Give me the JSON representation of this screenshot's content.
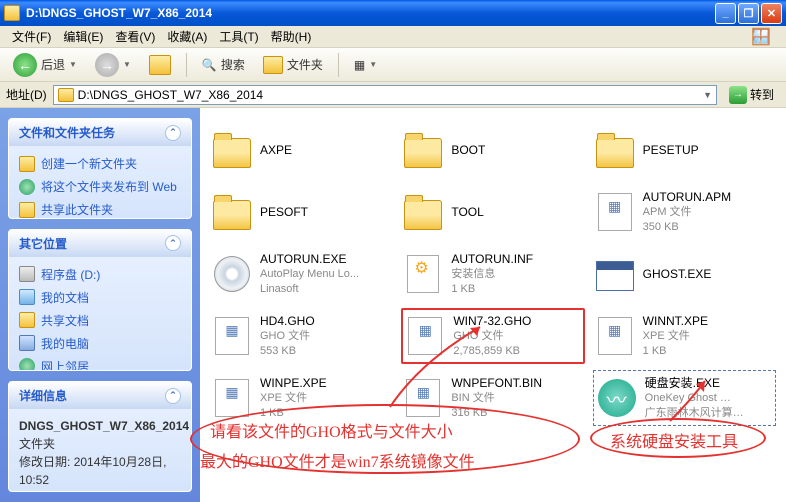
{
  "window": {
    "title": "D:\\DNGS_GHOST_W7_X86_2014"
  },
  "menu": {
    "file": "文件(F)",
    "edit": "编辑(E)",
    "view": "查看(V)",
    "fav": "收藏(A)",
    "tools": "工具(T)",
    "help": "帮助(H)"
  },
  "toolbar": {
    "back": "后退",
    "search": "搜索",
    "folders": "文件夹"
  },
  "address": {
    "label": "地址(D)",
    "value": "D:\\DNGS_GHOST_W7_X86_2014",
    "go": "转到"
  },
  "sidebar": {
    "tasks": {
      "title": "文件和文件夹任务",
      "items": [
        "创建一个新文件夹",
        "将这个文件夹发布到 Web",
        "共享此文件夹"
      ]
    },
    "places": {
      "title": "其它位置",
      "items": [
        "程序盘 (D:)",
        "我的文档",
        "共享文档",
        "我的电脑",
        "网上邻居"
      ]
    },
    "details": {
      "title": "详细信息",
      "name": "DNGS_GHOST_W7_X86_2014",
      "type": "文件夹",
      "modified_label": "修改日期:",
      "modified": "2014年10月28日, 10:52"
    }
  },
  "files": [
    {
      "name": "AXPE",
      "type": "folder"
    },
    {
      "name": "BOOT",
      "type": "folder"
    },
    {
      "name": "PESETUP",
      "type": "folder"
    },
    {
      "name": "PESOFT",
      "type": "folder"
    },
    {
      "name": "TOOL",
      "type": "folder"
    },
    {
      "name": "AUTORUN.APM",
      "sub1": "APM 文件",
      "sub2": "350 KB",
      "type": "gho"
    },
    {
      "name": "AUTORUN.EXE",
      "sub1": "AutoPlay Menu Lo...",
      "sub2": "Linasoft",
      "type": "cd"
    },
    {
      "name": "AUTORUN.INF",
      "sub1": "安装信息",
      "sub2": "1 KB",
      "type": "inf"
    },
    {
      "name": "GHOST.EXE",
      "type": "win"
    },
    {
      "name": "HD4.GHO",
      "sub1": "GHO 文件",
      "sub2": "553 KB",
      "type": "gho"
    },
    {
      "name": "WIN7-32.GHO",
      "sub1": "GHO 文件",
      "sub2": "2,785,859 KB",
      "type": "gho",
      "hl": "red"
    },
    {
      "name": "WINNT.XPE",
      "sub1": "XPE 文件",
      "sub2": "1 KB",
      "type": "gho"
    },
    {
      "name": "WINPE.XPE",
      "sub1": "XPE 文件",
      "sub2": "1 KB",
      "type": "gho"
    },
    {
      "name": "WNPEFONT.BIN",
      "sub1": "BIN 文件",
      "sub2": "316 KB",
      "type": "gho"
    },
    {
      "name": "硬盘安装.EXE",
      "sub1": "OneKey Ghost …",
      "sub2": "广东雨林木风计算…",
      "type": "swirl",
      "hl": "dotted"
    }
  ],
  "annotations": {
    "line1": "请看该文件的GHO格式与文件大小",
    "line2": "最大的GHO文件才是win7系统镜像文件",
    "line3": "系统硬盘安装工具"
  }
}
